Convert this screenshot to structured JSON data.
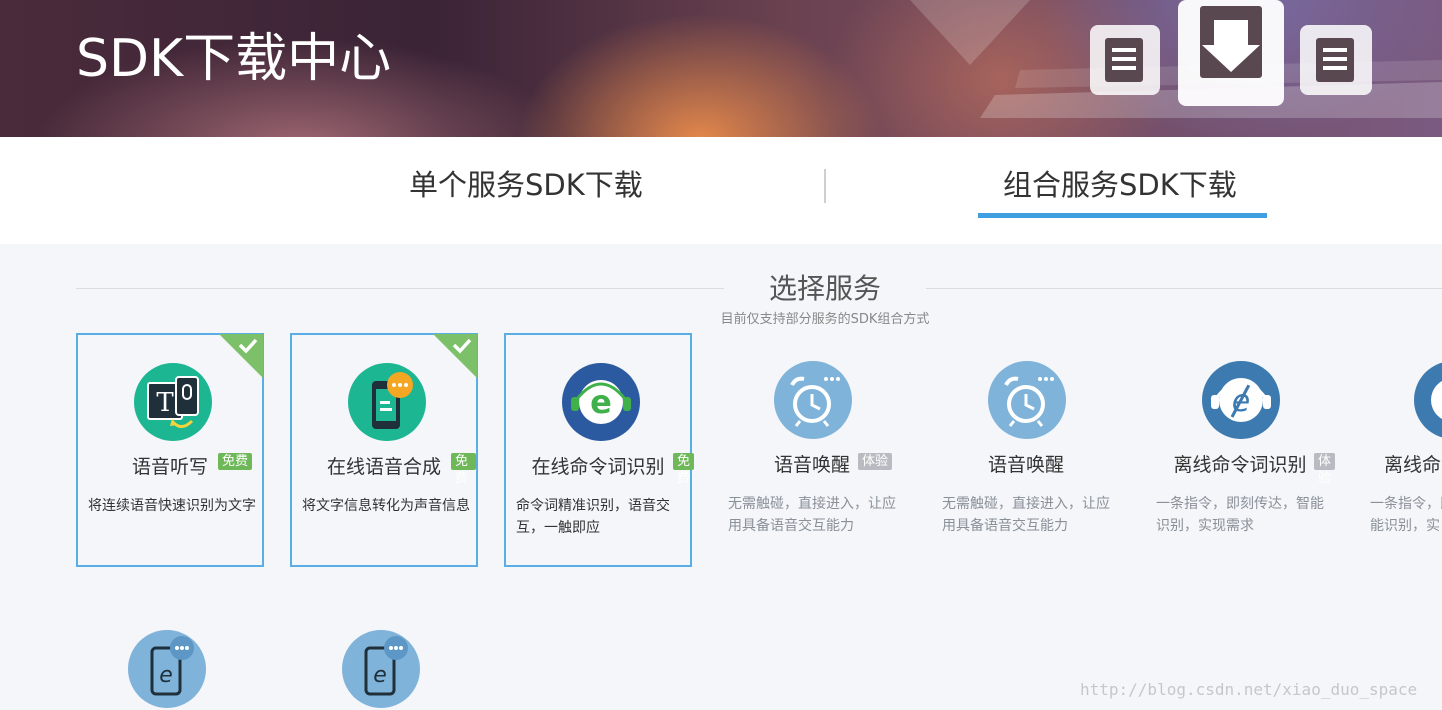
{
  "header": {
    "title": "SDK下载中心"
  },
  "tabs": [
    {
      "label": "单个服务SDK下载",
      "active": false
    },
    {
      "label": "组合服务SDK下载",
      "active": true
    }
  ],
  "section": {
    "title": "选择服务",
    "subtitle": "目前仅支持部分服务的SDK组合方式"
  },
  "services": [
    {
      "name": "语音听写",
      "badge": "免费",
      "desc": "将连续语音快速识别为文字",
      "selected": true,
      "icon": "speech-dictation-icon"
    },
    {
      "name": "在线语音合成",
      "badge": "免费",
      "desc": "将文字信息转化为声音信息",
      "selected": true,
      "icon": "speech-synthesis-icon"
    },
    {
      "name": "在线命令词识别",
      "badge": "免费",
      "desc": "命令词精准识别，语音交互，一触即应",
      "selected": false,
      "icon": "command-recognition-icon"
    },
    {
      "name": "语音唤醒",
      "badge": "体验",
      "desc": "无需触碰，直接进入，让应用具备语音交互能力",
      "selected": false,
      "icon": "voice-wakeup-icon"
    },
    {
      "name": "语音唤醒",
      "badge": "",
      "desc": "无需触碰，直接进入，让应用具备语音交互能力",
      "selected": false,
      "icon": "voice-wakeup-icon"
    },
    {
      "name": "离线命令词识别",
      "badge": "体验",
      "desc": "一条指令，即刻传达，智能识别，实现需求",
      "selected": false,
      "icon": "offline-command-icon"
    },
    {
      "name": "离线命令",
      "badge": "",
      "desc": "一条指令，即刻传达，智能识别，实",
      "selected": false,
      "icon": "offline-command-icon"
    }
  ],
  "watermark": "http://blog.csdn.net/xiao_duo_space",
  "colors": {
    "accent": "#3f9fe0",
    "free_badge": "#6fb85a",
    "trial_badge": "#b8bcc2",
    "selected_border": "#5aaee3",
    "check_corner": "#7dc06a"
  }
}
